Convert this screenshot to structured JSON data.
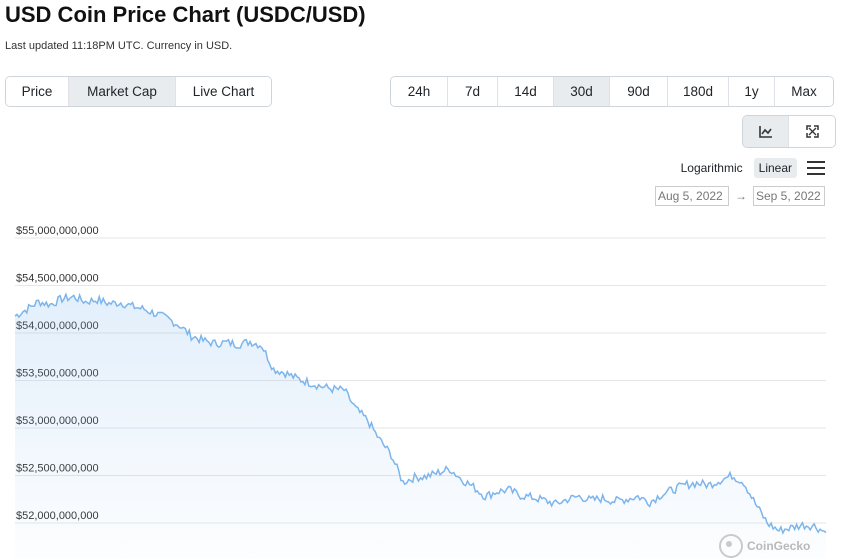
{
  "header": {
    "title": "USD Coin Price Chart (USDC/USD)",
    "subtitle": "Last updated 11:18PM UTC. Currency in USD."
  },
  "view_tabs": [
    {
      "label": "Price",
      "active": false
    },
    {
      "label": "Market Cap",
      "active": true
    },
    {
      "label": "Live Chart",
      "active": false
    }
  ],
  "range_tabs": [
    {
      "label": "24h",
      "active": false
    },
    {
      "label": "7d",
      "active": false
    },
    {
      "label": "14d",
      "active": false
    },
    {
      "label": "30d",
      "active": true
    },
    {
      "label": "90d",
      "active": false
    },
    {
      "label": "180d",
      "active": false
    },
    {
      "label": "1y",
      "active": false
    },
    {
      "label": "Max",
      "active": false
    }
  ],
  "tools": {
    "line_chart_icon": "line-chart-icon",
    "fullscreen_icon": "fullscreen-icon",
    "active": "line_chart"
  },
  "scale": {
    "logarithmic": "Logarithmic",
    "linear": "Linear",
    "active": "linear"
  },
  "date_range": {
    "from": "Aug 5, 2022",
    "separator": "→",
    "to": "Sep 5, 2022"
  },
  "watermark": "CoinGecko",
  "colors": {
    "line": "#7cb5ec",
    "active_tab": "#e9ecef"
  },
  "chart_data": {
    "type": "area",
    "title": "",
    "xlabel": "",
    "ylabel": "",
    "x_range": [
      "Aug 5, 2022",
      "Sep 5, 2022"
    ],
    "y_ticks": [
      {
        "value": 55000000000,
        "label": "$55,000,000,000"
      },
      {
        "value": 54500000000,
        "label": "$54,500,000,000"
      },
      {
        "value": 54000000000,
        "label": "$54,000,000,000"
      },
      {
        "value": 53500000000,
        "label": "$53,500,000,000"
      },
      {
        "value": 53000000000,
        "label": "$53,000,000,000"
      },
      {
        "value": 52500000000,
        "label": "$52,500,000,000"
      },
      {
        "value": 52000000000,
        "label": "$52,000,000,000"
      }
    ],
    "ylim": [
      51800000000,
      55000000000
    ],
    "grid": true,
    "legend": "none",
    "series": [
      {
        "values_billions": [
          54.18,
          54.25,
          54.33,
          54.3,
          54.36,
          54.38,
          54.33,
          54.35,
          54.31,
          54.32,
          54.28,
          54.25,
          54.2,
          54.15,
          54.08,
          53.97,
          53.92,
          53.89,
          53.9,
          53.88,
          53.91,
          53.87,
          53.62,
          53.58,
          53.52,
          53.48,
          53.44,
          53.41,
          53.4,
          53.2,
          53.08,
          52.88,
          52.72,
          52.43,
          52.48,
          52.49,
          52.53,
          52.57,
          52.46,
          52.38,
          52.28,
          52.33,
          52.35,
          52.29,
          52.27,
          52.24,
          52.2,
          52.25,
          52.28,
          52.24,
          52.26,
          52.23,
          52.25,
          52.28,
          52.22,
          52.3,
          52.35,
          52.4,
          52.42,
          52.4,
          52.45,
          52.5,
          52.43,
          52.2,
          52.0,
          51.92,
          51.95,
          51.98,
          51.97,
          51.9
        ]
      }
    ]
  }
}
